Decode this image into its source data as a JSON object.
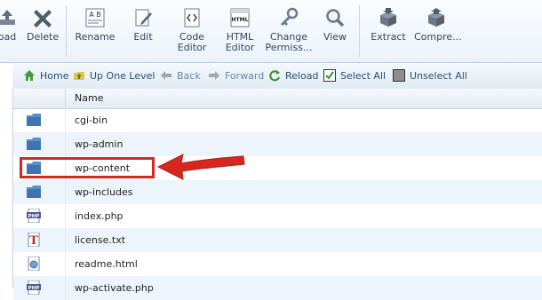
{
  "toolbar": {
    "items": [
      {
        "label": "oad",
        "icon": "upload-icon"
      },
      {
        "label": "Delete",
        "icon": "delete-icon"
      },
      {
        "label": "Rename",
        "icon": "rename-icon"
      },
      {
        "label": "Edit",
        "icon": "edit-icon"
      },
      {
        "label": "Code\nEditor",
        "icon": "code-editor-icon"
      },
      {
        "label": "HTML\nEditor",
        "icon": "html-editor-icon"
      },
      {
        "label": "Change\nPermiss...",
        "icon": "permissions-icon"
      },
      {
        "label": "View",
        "icon": "view-icon"
      },
      {
        "label": "Extract",
        "icon": "extract-icon"
      },
      {
        "label": "Compre...",
        "icon": "compress-icon"
      }
    ],
    "rename_glyphs": "A B",
    "html_glyph": "HTML"
  },
  "nav": {
    "home": "Home",
    "up": "Up One Level",
    "back": "Back",
    "forward": "Forward",
    "reload": "Reload",
    "select_all": "Select All",
    "unselect_all": "Unselect All"
  },
  "file_list": {
    "header_name": "Name",
    "rows": [
      {
        "name": "cgi-bin",
        "type": "folder"
      },
      {
        "name": "wp-admin",
        "type": "folder"
      },
      {
        "name": "wp-content",
        "type": "folder"
      },
      {
        "name": "wp-includes",
        "type": "folder"
      },
      {
        "name": "index.php",
        "type": "php"
      },
      {
        "name": "license.txt",
        "type": "txt"
      },
      {
        "name": "readme.html",
        "type": "html"
      },
      {
        "name": "wp-activate.php",
        "type": "php"
      }
    ],
    "php_glyph": "PHP",
    "txt_glyph": "T"
  },
  "colors": {
    "highlight": "#d8271e",
    "folder": "#5b8fc7",
    "nav_text": "#2d4d6e"
  }
}
